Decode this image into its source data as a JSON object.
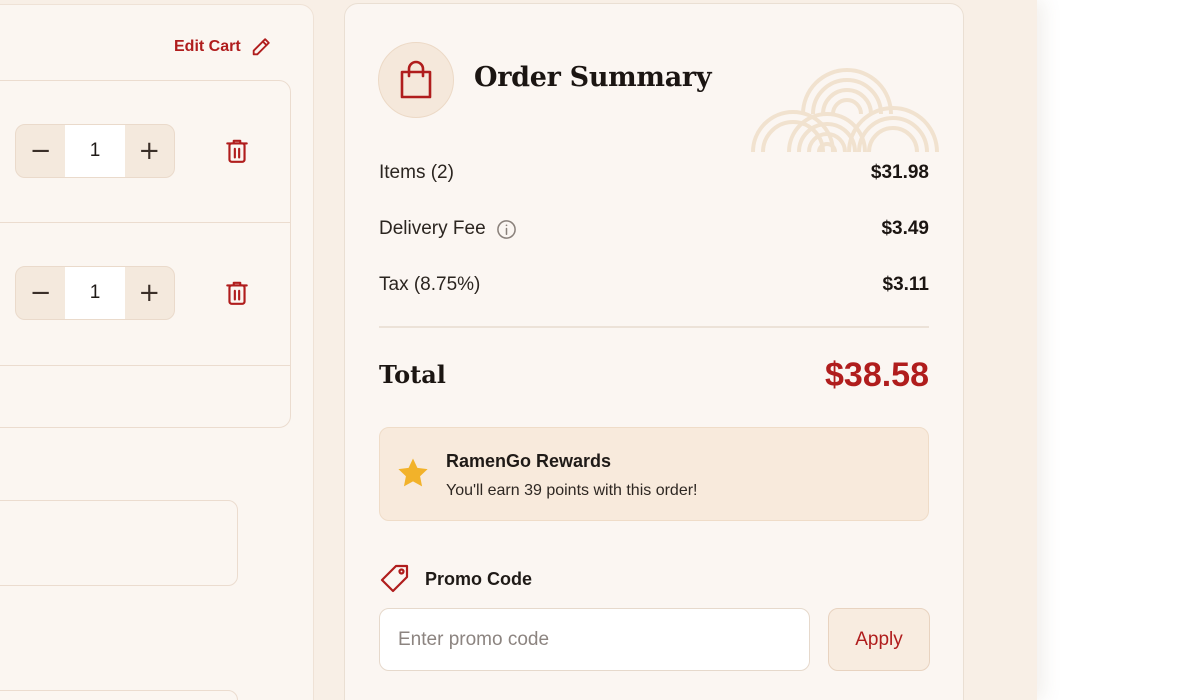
{
  "cart": {
    "edit_label": "Edit Cart",
    "items": [
      {
        "quantity": "1"
      },
      {
        "quantity": "1"
      }
    ],
    "stepper": {
      "minus": "−",
      "plus": "+"
    }
  },
  "summary": {
    "title": "Order Summary",
    "rows": {
      "items": {
        "label": "Items (2)",
        "value": "$31.98"
      },
      "delivery": {
        "label": "Delivery Fee",
        "value": "$3.49"
      },
      "tax": {
        "label": "Tax (8.75%)",
        "value": "$3.11"
      }
    },
    "total": {
      "label": "Total",
      "value": "$38.58"
    },
    "rewards": {
      "title": "RamenGo Rewards",
      "subtitle": "You'll earn 39 points with this order!"
    },
    "promo": {
      "label": "Promo Code",
      "placeholder": "Enter promo code",
      "value": "",
      "apply_label": "Apply"
    }
  },
  "icons": {
    "edit": "pencil-icon",
    "trash": "trash-icon",
    "bag": "shopping-bag-icon",
    "info": "info-icon",
    "star": "star-icon",
    "tag": "tag-icon"
  },
  "colors": {
    "accent": "#b01d1d",
    "background": "#f8efe6",
    "panel": "#fbf6f2",
    "star": "#f2b22a"
  }
}
